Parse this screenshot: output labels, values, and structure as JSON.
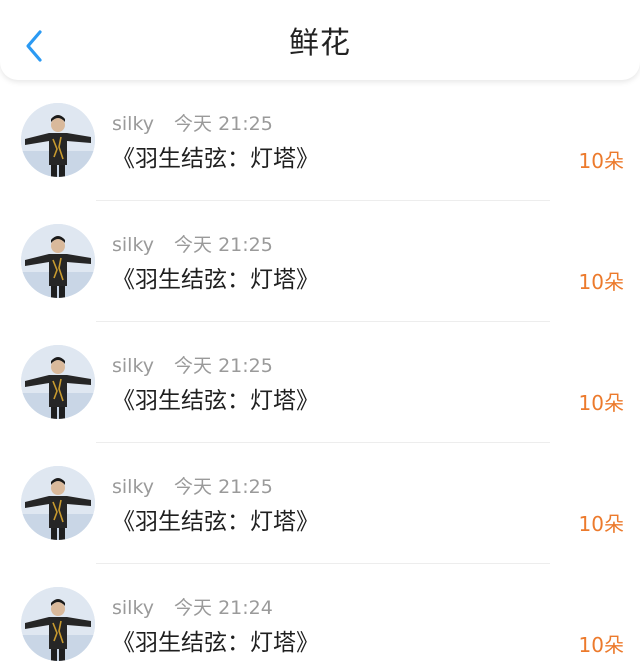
{
  "header": {
    "title": "鲜花",
    "back_icon": "chevron-left-icon",
    "accent_color": "#2b9af3"
  },
  "list": {
    "items": [
      {
        "user": "silky",
        "time": "今天 21:25",
        "gift": "《羽生结弦：灯塔》",
        "count": "10朵"
      },
      {
        "user": "silky",
        "time": "今天 21:25",
        "gift": "《羽生结弦：灯塔》",
        "count": "10朵"
      },
      {
        "user": "silky",
        "time": "今天 21:25",
        "gift": "《羽生结弦：灯塔》",
        "count": "10朵"
      },
      {
        "user": "silky",
        "time": "今天 21:25",
        "gift": "《羽生结弦：灯塔》",
        "count": "10朵"
      },
      {
        "user": "silky",
        "time": "今天 21:24",
        "gift": "《羽生结弦：灯塔》",
        "count": "10朵"
      }
    ],
    "count_color": "#ec7a2c"
  }
}
